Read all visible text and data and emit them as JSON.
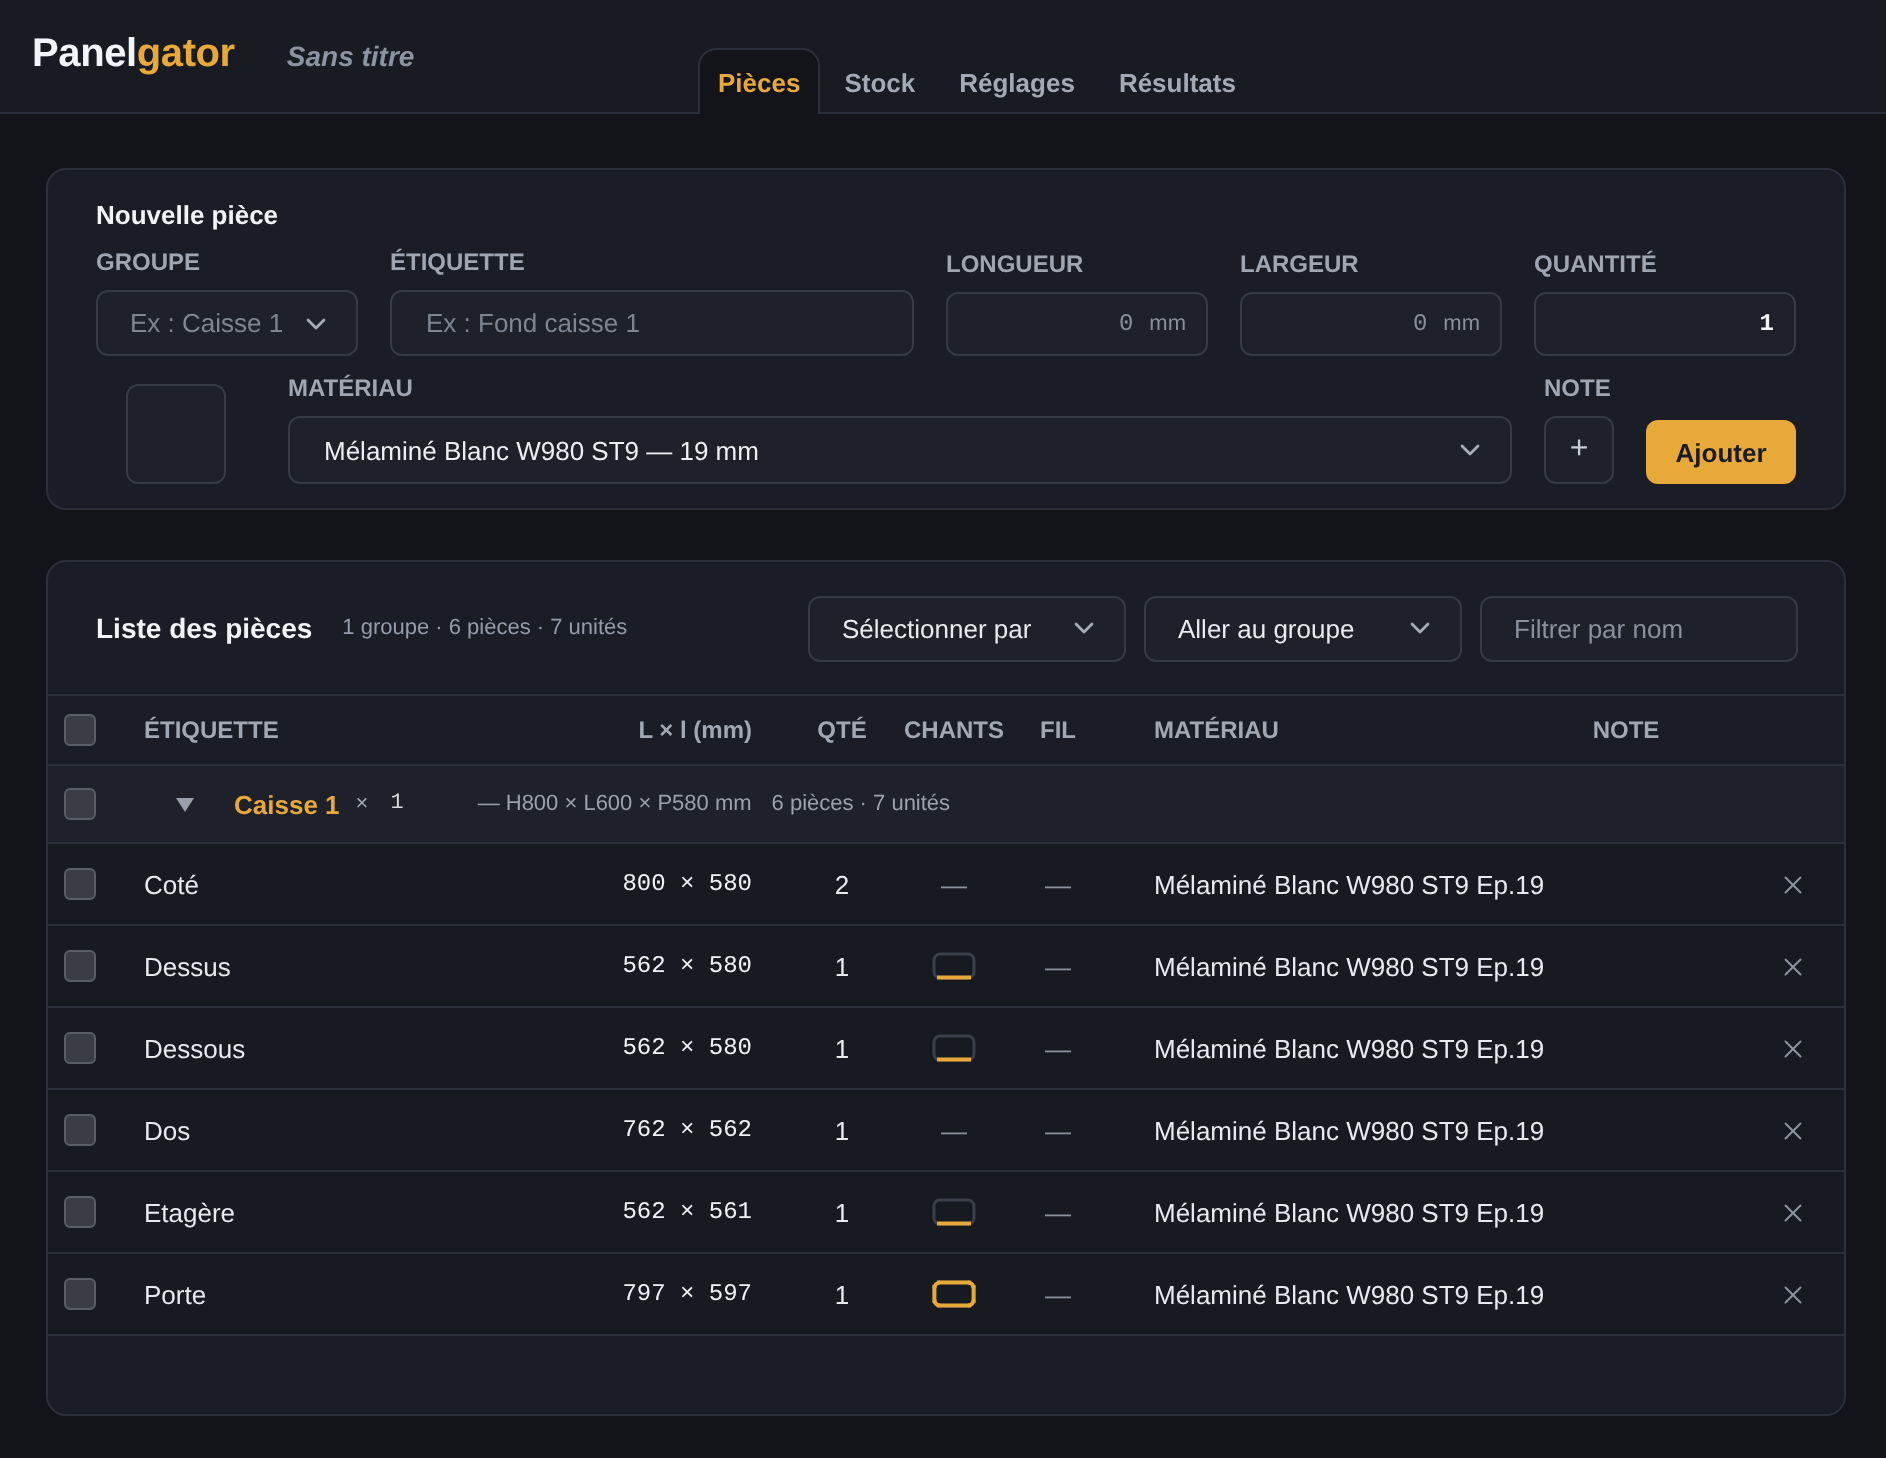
{
  "header": {
    "logo": {
      "primary": "Panel",
      "accent": "gator"
    },
    "document_title": "Sans titre",
    "tabs": [
      {
        "label": "Pièces",
        "selected": true
      },
      {
        "label": "Stock",
        "selected": false
      },
      {
        "label": "Réglages",
        "selected": false
      },
      {
        "label": "Résultats",
        "selected": false
      }
    ]
  },
  "new_piece_form": {
    "title": "Nouvelle pièce",
    "fields": [
      {
        "kind": "select",
        "label": "GROUPE",
        "placeholder": "Ex : Caisse 1"
      },
      {
        "kind": "text",
        "label": "ÉTIQUETTE",
        "placeholder": "Ex : Fond caisse 1"
      },
      {
        "kind": "number",
        "label": "LONGUEUR",
        "placeholder": "0",
        "unit": "mm"
      },
      {
        "kind": "number",
        "label": "LARGEUR",
        "placeholder": "0",
        "unit": "mm"
      },
      {
        "kind": "number",
        "label": "QUANTITÉ",
        "value": "1"
      }
    ],
    "material": {
      "label": "MATÉRIAU",
      "value": "Mélaminé Blanc W980 ST9 — 19 mm"
    },
    "note": {
      "label": "NOTE",
      "button": "+"
    },
    "submit": "Ajouter"
  },
  "pieces_list": {
    "title": "Liste des pièces",
    "summary": "1 groupe · 6 pièces · 7 unités",
    "select_by": "Sélectionner par",
    "go_to_group": "Aller au groupe",
    "filter": {
      "placeholder": "Filtrer par nom"
    }
  },
  "table": {
    "select_all": {
      "checked": false
    },
    "columns": [
      "ÉTIQUETTE",
      "L × l (mm)",
      "QTÉ",
      "CHANTS",
      "FIL",
      "MATÉRIAU",
      "NOTE"
    ],
    "groups": [
      {
        "name": "Caisse 1",
        "checked": false,
        "expanded": true,
        "multiplier": "×",
        "count": "1",
        "dimensions": "— H800 × L600 × P580 mm",
        "summary": "6 pièces · 7 unités",
        "rows": [
          {
            "checked": false,
            "label": "Coté",
            "size": "800 × 580",
            "quantity": "2",
            "edges": {
              "kind": "text",
              "text": "—"
            },
            "grain": "—",
            "material": "Mélaminé Blanc W980 ST9 Ep.19"
          },
          {
            "checked": false,
            "label": "Dessus",
            "size": "562 × 580",
            "quantity": "1",
            "edges": {
              "kind": "banding",
              "top": false,
              "right": false,
              "bottom": true,
              "left": false
            },
            "grain": "—",
            "material": "Mélaminé Blanc W980 ST9 Ep.19"
          },
          {
            "checked": false,
            "label": "Dessous",
            "size": "562 × 580",
            "quantity": "1",
            "edges": {
              "kind": "banding",
              "top": false,
              "right": false,
              "bottom": true,
              "left": false
            },
            "grain": "—",
            "material": "Mélaminé Blanc W980 ST9 Ep.19"
          },
          {
            "checked": false,
            "label": "Dos",
            "size": "762 × 562",
            "quantity": "1",
            "edges": {
              "kind": "text",
              "text": "—"
            },
            "grain": "—",
            "material": "Mélaminé Blanc W980 ST9 Ep.19"
          },
          {
            "checked": false,
            "label": "Etagère",
            "size": "562 × 561",
            "quantity": "1",
            "edges": {
              "kind": "banding",
              "top": false,
              "right": false,
              "bottom": true,
              "left": false
            },
            "grain": "—",
            "material": "Mélaminé Blanc W980 ST9 Ep.19"
          },
          {
            "checked": false,
            "label": "Porte",
            "size": "797 × 597",
            "quantity": "1",
            "edges": {
              "kind": "banding",
              "top": true,
              "right": true,
              "bottom": true,
              "left": true
            },
            "grain": "—",
            "material": "Mélaminé Blanc W980 ST9 Ep.19"
          }
        ]
      }
    ]
  }
}
